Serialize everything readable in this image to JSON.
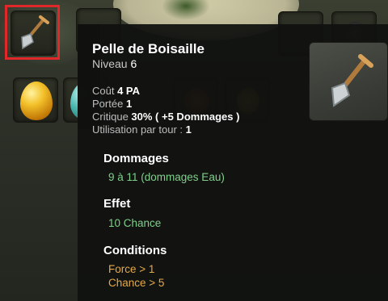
{
  "item": {
    "name": "Pelle de Boisaille",
    "level_label": "Niveau",
    "level_value": "6",
    "icon": "shovel-icon"
  },
  "stats": {
    "cost_label": "Coût",
    "cost_value": "4 PA",
    "range_label": "Portée",
    "range_value": "1",
    "crit_label": "Critique",
    "crit_value": "30% ( +5 Dommages )",
    "use_label": "Utilisation par tour :",
    "use_value": "1"
  },
  "sections": {
    "damage_title": "Dommages",
    "damage_line": "9 à 11 (dommages Eau)",
    "effect_title": "Effet",
    "effect_line": "10 Chance",
    "conditions_title": "Conditions",
    "condition_lines": [
      "Force > 1",
      "Chance > 5"
    ]
  },
  "colors": {
    "selection": "#e0282b",
    "green_text": "#7ed08b",
    "orange_text": "#e6a94a"
  }
}
